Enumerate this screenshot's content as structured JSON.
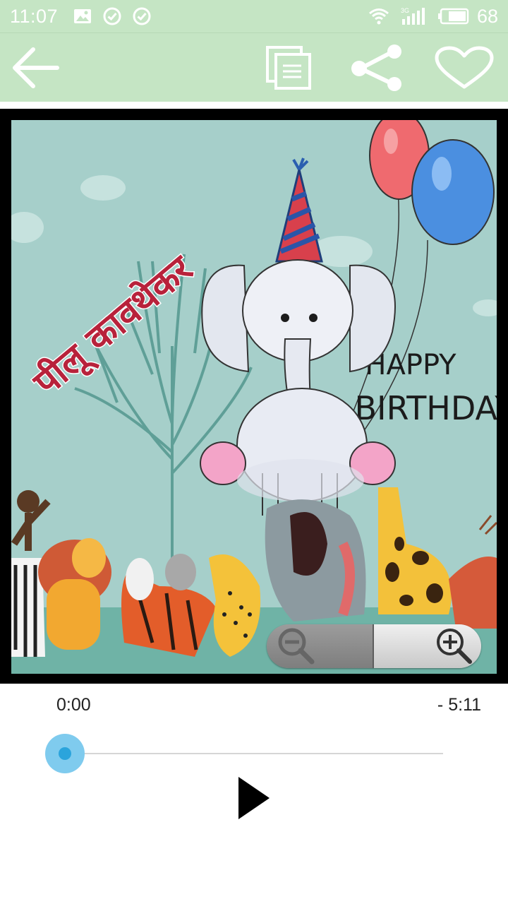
{
  "status_bar": {
    "time": "11:07",
    "network": "3G",
    "battery": "68",
    "icons": [
      "image-icon",
      "check-circle-icon",
      "check-circle-icon",
      "wifi-icon",
      "signal-icon",
      "battery-icon"
    ]
  },
  "toolbar": {
    "background": "#c5e5c4",
    "icons": [
      "back-arrow-icon",
      "copy-icon",
      "share-icon",
      "heart-icon"
    ]
  },
  "card": {
    "hindi_name": "पीलू कावथेकर",
    "greeting_line1": "Happy",
    "greeting_line2": "Birthday"
  },
  "zoom": {
    "icons": [
      "zoom-out-icon",
      "zoom-in-icon"
    ]
  },
  "player": {
    "elapsed": "0:00",
    "remaining": "- 5:11",
    "progress": 0,
    "accent": "#2ba4dc",
    "icons": [
      "play-icon"
    ]
  }
}
